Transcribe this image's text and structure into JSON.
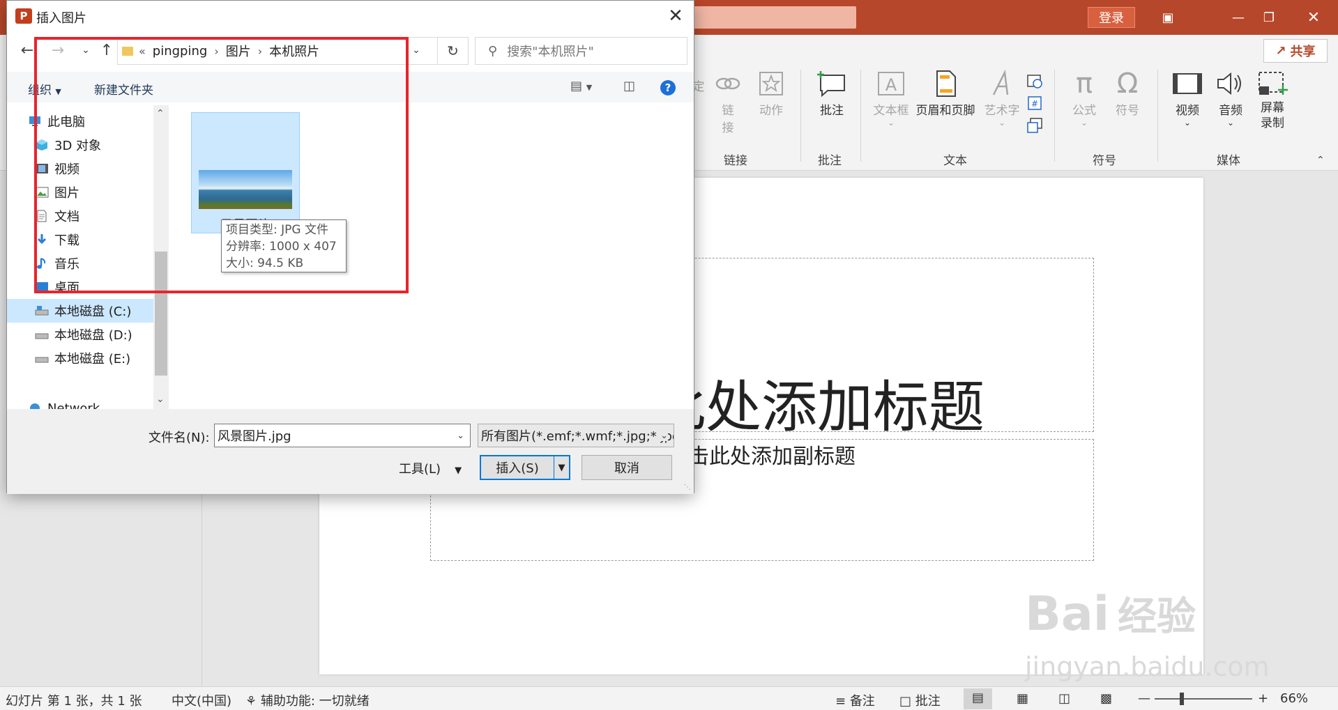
{
  "app": {
    "login_label": "登录",
    "share_label": "共享",
    "ribbon": {
      "buttons": [
        {
          "label": "定",
          "dim": true
        },
        {
          "label": "链接",
          "dim": true
        },
        {
          "label": "动作",
          "dim": true
        },
        {
          "label": "批注",
          "dim": false
        },
        {
          "label": "文本框",
          "dim": true
        },
        {
          "label": "页眉和页脚",
          "dim": false
        },
        {
          "label": "艺术字",
          "dim": true
        },
        {
          "label": "公式",
          "dim": true
        },
        {
          "label": "符号",
          "dim": true
        },
        {
          "label": "视频",
          "dim": false
        },
        {
          "label": "音频",
          "dim": false
        },
        {
          "label": "屏幕录制",
          "dim": false
        }
      ],
      "groups": [
        "链接",
        "批注",
        "文本",
        "符号",
        "媒体"
      ]
    },
    "slide": {
      "title_placeholder": "单击此处添加标题",
      "subtitle_placeholder": "单击此处添加副标题"
    },
    "watermark": {
      "line1": "Bai",
      "line1b": "经验",
      "line2": "jingyan.baidu.com"
    },
    "status": {
      "slide_info": "幻灯片 第 1 张，共 1 张",
      "language": "中文(中国)",
      "accessibility": "辅助功能: 一切就绪",
      "notes": "备注",
      "comments": "批注",
      "zoom": "66%"
    }
  },
  "dialog": {
    "title": "插入图片",
    "path": [
      "pingping",
      "图片",
      "本机照片"
    ],
    "path_prefix": "«",
    "search_placeholder": "搜索\"本机照片\"",
    "organize": "组织",
    "new_folder": "新建文件夹",
    "tree": [
      {
        "label": "此电脑",
        "icon": "computer-icon"
      },
      {
        "label": "3D 对象",
        "icon": "cube-icon"
      },
      {
        "label": "视频",
        "icon": "film-icon"
      },
      {
        "label": "图片",
        "icon": "picture-icon"
      },
      {
        "label": "文档",
        "icon": "document-icon"
      },
      {
        "label": "下载",
        "icon": "download-icon"
      },
      {
        "label": "音乐",
        "icon": "music-icon"
      },
      {
        "label": "桌面",
        "icon": "desktop-icon"
      },
      {
        "label": "本地磁盘 (C:)",
        "icon": "drive-icon"
      },
      {
        "label": "本地磁盘 (D:)",
        "icon": "drive-icon"
      },
      {
        "label": "本地磁盘 (E:)",
        "icon": "drive-icon"
      },
      {
        "label": "Network",
        "icon": "network-icon"
      }
    ],
    "selected_tree_index": 8,
    "file": {
      "name": "风景图片",
      "tooltip_type": "项目类型: JPG 文件",
      "tooltip_resolution": "分辨率: 1000 x 407",
      "tooltip_size": "大小: 94.5 KB"
    },
    "filename_label": "文件名(N):",
    "filename_value": "风景图片.jpg",
    "filter_value": "所有图片(*.emf;*.wmf;*.jpg;*.jpeg;*.png)",
    "tools_label": "工具(L)",
    "insert_label": "插入(S)",
    "cancel_label": "取消"
  }
}
